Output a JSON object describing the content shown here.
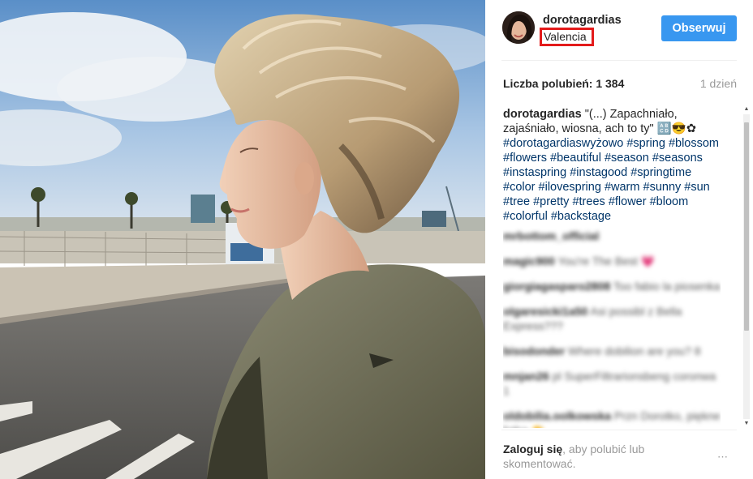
{
  "post": {
    "username": "dorotagardias",
    "location": "Valencia",
    "follow_label": "Obserwuj",
    "likes_text": "Liczba polubień: 1 384",
    "age": "1 dzień"
  },
  "caption": {
    "user": "dorotagardias",
    "text": "\"(...) Zapachniało, zajaśniało, wiosna, ach to ty\" 🔠😎✿",
    "hashtags": [
      "#dorotagardiaswyżowo",
      "#spring",
      "#blossom",
      "#flowers",
      "#beautiful",
      "#season",
      "#seasons",
      "#instaspring",
      "#instagood",
      "#springtime",
      "#color",
      "#ilovespring",
      "#warm",
      "#sunny",
      "#sun",
      "#tree",
      "#pretty",
      "#trees",
      "#flower",
      "#bloom",
      "#colorful",
      "#backstage"
    ]
  },
  "blurred_comments": [
    {
      "user": "mrbottom_official",
      "text": ""
    },
    {
      "user": "magic900",
      "text": "You're The Best 💗"
    },
    {
      "user": "giorgiagasparo2808",
      "text": "Too fabio la piosenka"
    },
    {
      "user": "olgaresicki1a50",
      "text": "Asi possibl z Bella Express???"
    },
    {
      "user": "bisodonder",
      "text": "Where dobilion are you? 8"
    },
    {
      "user": "mnjan26",
      "text": "pl SuperFiltrarionsbeng coronwa 1"
    },
    {
      "user": "oldobilia.oolkowska",
      "text": "Przn Dorotko, piękne fotka 👏"
    },
    {
      "user": "",
      "text": "..."
    }
  ],
  "footer": {
    "login_label": "Zaloguj się",
    "rest_label": ", aby polubić lub skomentować.",
    "more_label": "⋯"
  },
  "icons": {
    "scroll_up": "arrow-up-icon",
    "scroll_down": "arrow-down-icon",
    "more": "more-options-icon"
  },
  "colors": {
    "follow_button": "#3897f0",
    "location_highlight": "#e31b1b",
    "hashtag": "#003569"
  }
}
